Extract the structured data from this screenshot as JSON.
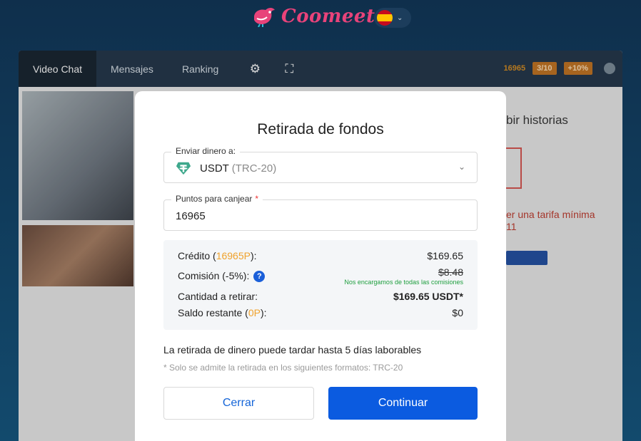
{
  "header": {
    "logo_text": "Coomeet",
    "language_flag": "spain-flag-icon"
  },
  "app": {
    "nav_tabs": [
      "Video Chat",
      "Mensajes",
      "Ranking"
    ],
    "points": "16965",
    "badge_level": "3/10",
    "badge_bonus": "+10%",
    "side_heading": "bir historias",
    "side_warning_line1": "er una tarifa mínima",
    "side_warning_line2": "11"
  },
  "modal": {
    "title": "Retirada de fondos",
    "send_label": "Enviar dinero a:",
    "send_currency": "USDT",
    "send_network": "(TRC-20)",
    "points_label": "Puntos para canjear",
    "points_required_mark": "*",
    "points_value": "16965",
    "credit_label_pre": "Crédito (",
    "credit_label_points": "16965P",
    "credit_label_post": "):",
    "credit_value": "$169.65",
    "commission_label": "Comisión (-5%):",
    "commission_help": "?",
    "commission_value": "$8.48",
    "commission_note": "Nos encargamos de todas las comisiones",
    "withdraw_label": "Cantidad a retirar:",
    "withdraw_value": "$169.65 USDT*",
    "balance_label_pre": "Saldo restante (",
    "balance_label_points": "0P",
    "balance_label_post": "):",
    "balance_value": "$0",
    "info_text": "La retirada de dinero puede tardar hasta 5 días laborables",
    "info_note": "* Solo se admite la retirada en los siguientes formatos: TRC-20",
    "close_label": "Cerrar",
    "continue_label": "Continuar"
  },
  "colors": {
    "primary": "#0b5be0",
    "accent_points": "#f0a22c",
    "note_green": "#1e9e3e",
    "logo_pink": "#e8437a"
  }
}
